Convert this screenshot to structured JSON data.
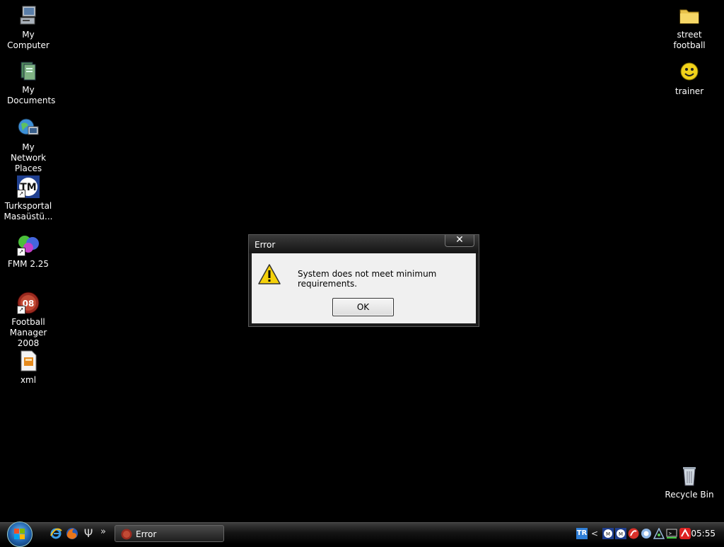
{
  "desktop": {
    "left_icons": [
      {
        "label": "My Computer",
        "icon": "computer-icon"
      },
      {
        "label": "My Documents",
        "icon": "documents-folder-icon"
      },
      {
        "label": "My Network Places",
        "icon": "network-globe-icon"
      },
      {
        "label": "Turksportal Masaüstü...",
        "icon": "tm-logo-icon"
      },
      {
        "label": "FMM 2.25",
        "icon": "fmm-ball-icon"
      },
      {
        "label": "Football Manager 2008",
        "icon": "fm08-icon"
      },
      {
        "label": "xml",
        "icon": "xml-file-icon"
      }
    ],
    "right_icons": [
      {
        "label": "street football",
        "icon": "folder-icon"
      },
      {
        "label": "trainer",
        "icon": "smiley-face-icon"
      },
      {
        "label": "Recycle Bin",
        "icon": "recycle-bin-icon"
      }
    ]
  },
  "dialog": {
    "title": "Error",
    "close_glyph": "✕",
    "message": "System does not meet minimum requirements.",
    "ok_label": "OK",
    "icon": "warning-icon"
  },
  "taskbar": {
    "start_icon": "windows-start-orb",
    "quick_launch": [
      "internet-explorer-icon",
      "firefox-icon",
      "psi-icon"
    ],
    "overflow_glyph": "»",
    "active_task": {
      "label": "Error",
      "icon": "fm08-icon"
    },
    "tray": {
      "language": "TR",
      "expand_glyph": "<",
      "time": "05:55"
    }
  },
  "colors": {
    "desktop_bg": "#000000",
    "dialog_client": "#f0f0f0",
    "warning_yellow": "#f5d10a"
  }
}
